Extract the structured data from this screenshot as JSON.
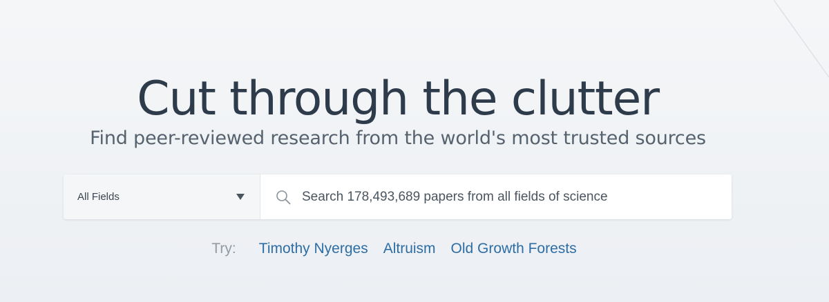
{
  "hero": {
    "title": "Cut through the clutter",
    "subtitle": "Find peer-reviewed research from the world's most trusted sources"
  },
  "search": {
    "field_select": {
      "selected": "All Fields",
      "icon": "chevron-down-icon"
    },
    "input": {
      "value": "",
      "placeholder": "Search 178,493,689 papers from all fields of science",
      "icon": "search-icon"
    }
  },
  "suggestions": {
    "label": "Try:",
    "items": [
      {
        "label": "Timothy Nyerges"
      },
      {
        "label": "Altruism"
      },
      {
        "label": "Old Growth Forests"
      }
    ]
  },
  "colors": {
    "title": "#2d3b4a",
    "subtitle": "#56626e",
    "link": "#2e6da4",
    "try_label": "#939aa2",
    "background": "#f0f2f5"
  }
}
